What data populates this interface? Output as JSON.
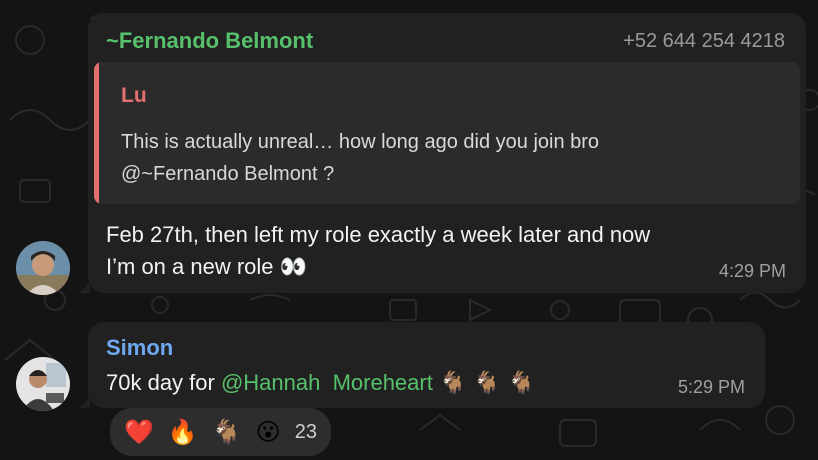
{
  "message1": {
    "sender": "~Fernando Belmont",
    "phone": "+52 644 254 4218",
    "reply": {
      "author": "Lu",
      "line1": "This is actually unreal… how long ago did you join bro",
      "line2": "@~Fernando Belmont ?"
    },
    "line1": "Feb 27th, then left my role exactly a week later and now",
    "line2_text": "I’m on a new role ",
    "line2_emoji": "👀",
    "time": "4:29 PM"
  },
  "message2": {
    "sender": "Simon",
    "text_prefix": "70k day for ",
    "mention": "@Hannah  Moreheart",
    "emojis": "🐐 🐐 🐐",
    "time": "5:29 PM",
    "reactions": {
      "heart": "❤️",
      "fire": "🔥",
      "goat": "🐐",
      "surprised": "😮",
      "count": "23"
    }
  },
  "colors": {
    "sender1": "#57c06b",
    "sender2": "#6fa8f0",
    "quote_accent": "#e2706d",
    "bubble": "#212121",
    "background": "#141414"
  }
}
